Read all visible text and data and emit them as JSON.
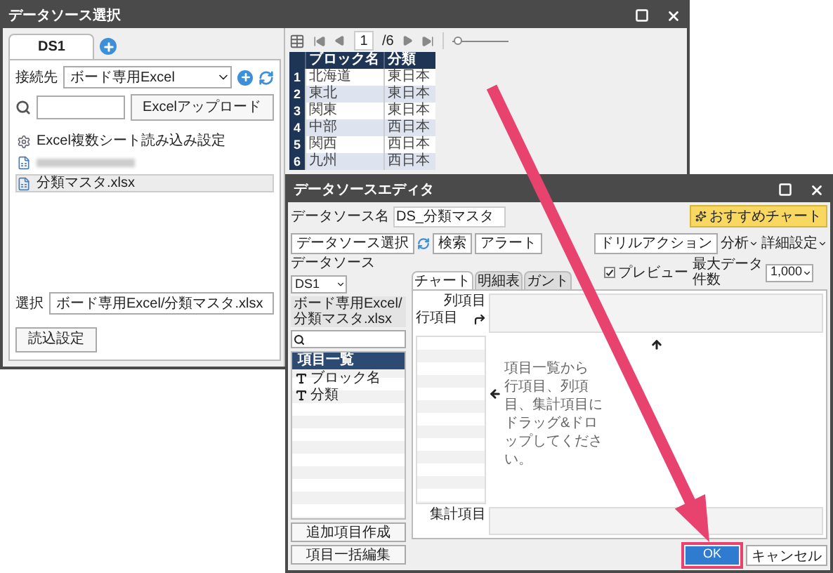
{
  "source_window": {
    "title": "データソース選択",
    "tabs": [
      {
        "label": "DS1",
        "selected": true
      }
    ],
    "connection": {
      "label": "接続先",
      "value": "ボード専用Excel"
    },
    "upload_button": "Excelアップロード",
    "files": [
      {
        "kind": "settings",
        "label": "Excel複数シート読み込み設定",
        "selected": false
      },
      {
        "kind": "blurred",
        "selected": false
      },
      {
        "kind": "file",
        "label": "分類マスタ.xlsx",
        "selected": true
      }
    ],
    "selection": {
      "label": "選択",
      "value": "ボード専用Excel/分類マスタ.xlsx"
    },
    "read_settings_button": "読込設定",
    "pager": {
      "page": "1",
      "total": "/6"
    },
    "zoom_slider": {
      "level": 0.1
    },
    "table": {
      "columns": [
        "ブロック名",
        "分類"
      ],
      "rows": [
        {
          "index": "1",
          "cells": [
            "北海道",
            "東日本"
          ]
        },
        {
          "index": "2",
          "cells": [
            "東北",
            "東日本"
          ]
        },
        {
          "index": "3",
          "cells": [
            "関東",
            "東日本"
          ]
        },
        {
          "index": "4",
          "cells": [
            "中部",
            "西日本"
          ]
        },
        {
          "index": "5",
          "cells": [
            "関西",
            "西日本"
          ]
        },
        {
          "index": "6",
          "cells": [
            "九州",
            "西日本"
          ]
        }
      ]
    }
  },
  "editor_window": {
    "title": "データソースエディタ",
    "name_field": {
      "label": "データソース名",
      "value": "DS_分類マスタ"
    },
    "recommend_button": "おすすめチャート",
    "select_button": "データソース選択",
    "actions": [
      "検索",
      "アラート",
      "ドリルアクション"
    ],
    "menus": [
      "分析",
      "詳細設定"
    ],
    "datasource": {
      "label": "データソース",
      "value": "DS1"
    },
    "path": "ボード専用Excel/分類マスタ.xlsx",
    "field_list": {
      "header": "項目一覧",
      "items": [
        "ブロック名",
        "分類"
      ]
    },
    "left_buttons": [
      "追加項目作成",
      "項目一括編集"
    ],
    "tabs": [
      {
        "label": "チャート",
        "selected": true
      },
      {
        "label": "明細表",
        "selected": false
      },
      {
        "label": "ガント",
        "selected": false
      }
    ],
    "preview": {
      "label": "プレビュー",
      "checked": true
    },
    "max_rows": {
      "label": "最大データ件数",
      "value": "1,000"
    },
    "column_label": "列項目",
    "row_label": "行項目",
    "message": [
      "項目一覧から",
      "行項目、列項目、集計項目に",
      "ドラッグ&ドロップしてください。"
    ],
    "aggregate_label": "集計項目",
    "ok_button": "OK",
    "cancel_button": "キャンセル"
  }
}
